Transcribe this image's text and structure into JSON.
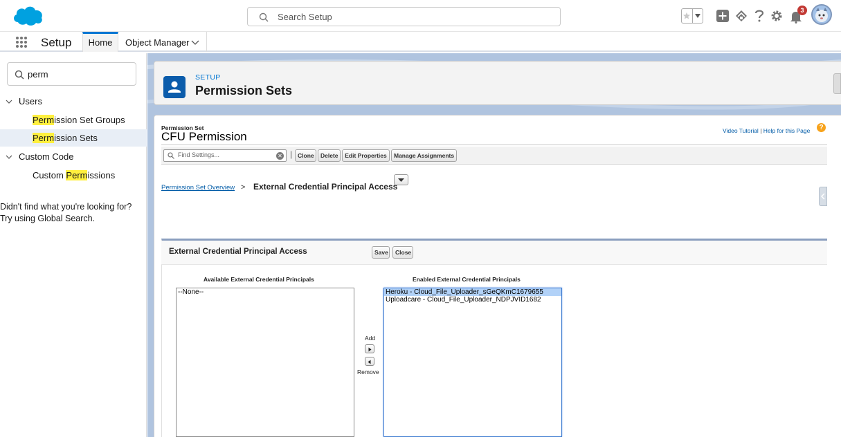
{
  "global_header": {
    "search_placeholder": "Search Setup",
    "notification_count": "3",
    "icons": [
      "salesforce-cloud-logo",
      "search-icon",
      "star-icon",
      "chevron-down-icon",
      "plus-icon",
      "trailhead-icon",
      "help-icon",
      "gear-icon",
      "bell-icon",
      "avatar"
    ]
  },
  "navbar": {
    "app_name": "Setup",
    "tabs": [
      {
        "label": "Home",
        "active": true
      },
      {
        "label": "Object Manager",
        "active": false
      }
    ]
  },
  "sidebar": {
    "quickfind_value": "perm",
    "tree": [
      {
        "type": "node",
        "label": "Users"
      },
      {
        "type": "leaf",
        "highlight": "Perm",
        "rest": "ission Set Groups",
        "selected": false
      },
      {
        "type": "leaf",
        "highlight": "Perm",
        "rest": "ission Sets",
        "selected": true
      },
      {
        "type": "node",
        "label": "Custom Code"
      },
      {
        "type": "leaf",
        "prefix": "Custom ",
        "highlight": "Perm",
        "rest": "issions",
        "selected": false
      }
    ],
    "help_line1": "Didn't find what you're looking for?",
    "help_line2": "Try using Global Search."
  },
  "page_header": {
    "kicker": "SETUP",
    "title": "Permission Sets"
  },
  "record": {
    "label": "Permission Set",
    "name": "CFU Permission",
    "video_tutorial": "Video Tutorial",
    "help_separator": "|",
    "help_page": "Help for this Page",
    "find_placeholder": "Find Settings...",
    "buttons": [
      "Clone",
      "Delete",
      "Edit Properties",
      "Manage Assignments"
    ],
    "toolbar_separator": "|"
  },
  "breadcrumb": {
    "link": "Permission Set Overview",
    "separator": ">",
    "current": "External Credential Principal Access"
  },
  "edit": {
    "title": "External Credential Principal Access",
    "save_label": "Save",
    "close_label": "Close",
    "available_header": "Available External Credential Principals",
    "enabled_header": "Enabled External Credential Principals",
    "add_label": "Add",
    "remove_label": "Remove",
    "available_options": [
      "--None--"
    ],
    "enabled_options": [
      {
        "label": "Heroku - Cloud_File_Uploader_sGeQKmC1679655",
        "selected": true
      },
      {
        "label": "Uploadcare - Cloud_File_Uploader_NDPJVID1682",
        "selected": false
      }
    ]
  },
  "colors": {
    "brand_blue": "#0176d3",
    "highlight_yellow": "#fff03f",
    "selected_row": "#e8eef6",
    "notification_red": "#c23934",
    "help_orange": "#f7a31c"
  }
}
